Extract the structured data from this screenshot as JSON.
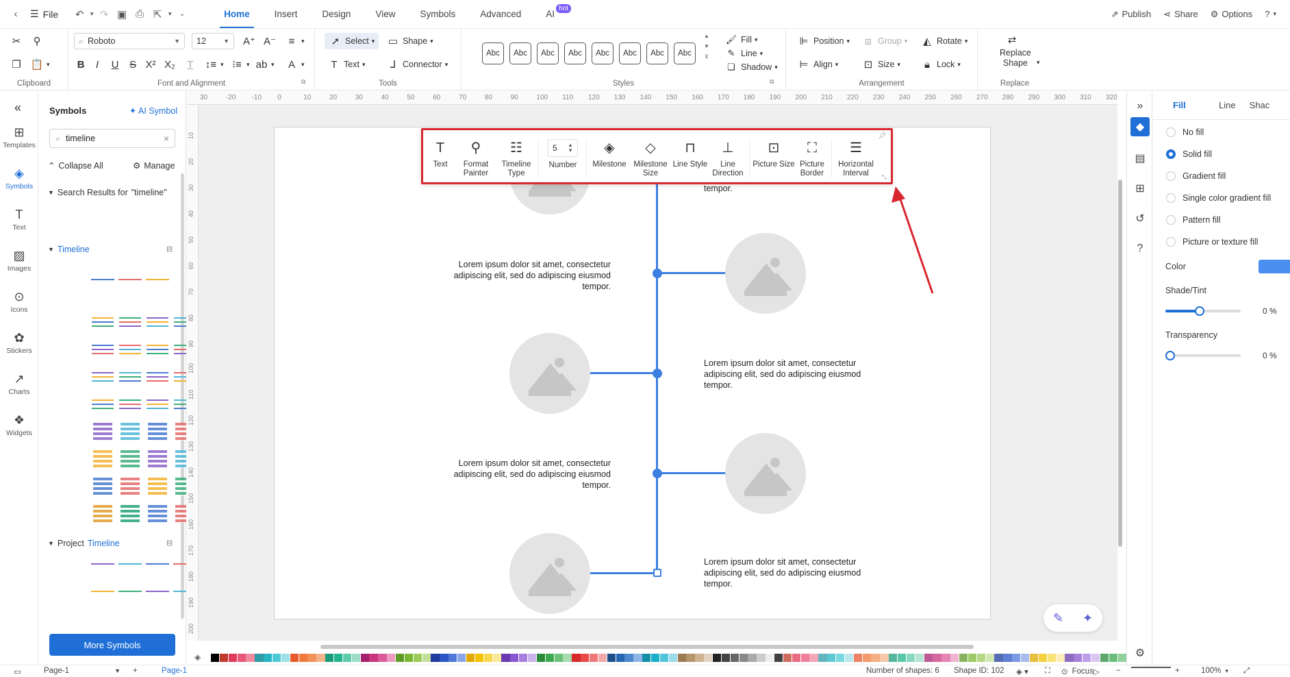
{
  "menubar": {
    "file_label": "File",
    "tabs": [
      {
        "label": "Home",
        "active": true
      },
      {
        "label": "Insert"
      },
      {
        "label": "Design"
      },
      {
        "label": "View"
      },
      {
        "label": "Symbols"
      },
      {
        "label": "Advanced"
      },
      {
        "label": "AI",
        "badge": "hot"
      }
    ],
    "right": {
      "publish": "Publish",
      "share": "Share",
      "options": "Options"
    }
  },
  "ribbon": {
    "font_name": "Roboto",
    "font_size": "12",
    "select_label": "Select",
    "shape_label": "Shape",
    "text_label": "Text",
    "connector_label": "Connector",
    "style_swatch": "Abc",
    "fill_label": "Fill",
    "line_label": "Line",
    "shadow_label": "Shadow",
    "position_label": "Position",
    "group_label": "Group",
    "rotate_label": "Rotate",
    "align_label": "Align",
    "size_label": "Size",
    "lock_label": "Lock",
    "replace_label_1": "Replace",
    "replace_label_2": "Shape",
    "groups": {
      "clipboard": "Clipboard",
      "font": "Font and Alignment",
      "tools": "Tools",
      "styles": "Styles",
      "arrangement": "Arrangement",
      "replace": "Replace"
    }
  },
  "rail": [
    {
      "label": "Templates",
      "icon": "templates-icon"
    },
    {
      "label": "Symbols",
      "icon": "symbols-icon",
      "active": true
    },
    {
      "label": "Text",
      "icon": "text-icon"
    },
    {
      "label": "Images",
      "icon": "images-icon"
    },
    {
      "label": "Icons",
      "icon": "icons-icon"
    },
    {
      "label": "Stickers",
      "icon": "stickers-icon"
    },
    {
      "label": "Charts",
      "icon": "charts-icon"
    },
    {
      "label": "Widgets",
      "icon": "widgets-icon"
    }
  ],
  "symbols": {
    "title": "Symbols",
    "ai_symbol": "AI Symbol",
    "search_value": "timeline",
    "collapse_all": "Collapse All",
    "manage": "Manage",
    "search_results_prefix": "Search Results for",
    "search_results_term": "\"timeline\"",
    "timeline_section": "Timeline",
    "project_prefix": "Project",
    "project_term": "Timeline",
    "more_symbols": "More Symbols"
  },
  "ruler": {
    "h": [
      "30",
      "-20",
      "-10",
      "0",
      "10",
      "20",
      "30",
      "40",
      "50",
      "60",
      "70",
      "80",
      "90",
      "100",
      "110",
      "120",
      "130",
      "140",
      "150",
      "160",
      "170",
      "180",
      "190",
      "200",
      "210",
      "220",
      "230",
      "240",
      "250",
      "260",
      "270",
      "280",
      "290",
      "300",
      "310",
      "320"
    ],
    "v": [
      "10",
      "20",
      "30",
      "40",
      "50",
      "60",
      "70",
      "80",
      "90",
      "100",
      "110",
      "120",
      "130",
      "140",
      "150",
      "160",
      "170",
      "180",
      "190",
      "200"
    ]
  },
  "canvas": {
    "lorem_line1": "Lorem ipsum dolor sit amet, consectetur",
    "lorem_line2": "adipiscing elit, sed do adipiscing eiusmod",
    "lorem_line3": "tempor.",
    "partial_text": "tempor."
  },
  "float_toolbar": {
    "items": [
      {
        "label": "Text",
        "icon": "text-tool-icon"
      },
      {
        "label": "Format\nPainter",
        "icon": "format-painter-icon"
      },
      {
        "label": "Timeline\nType",
        "icon": "timeline-type-icon"
      },
      {
        "label": "Number",
        "value": "5"
      },
      {
        "label": "Milestone",
        "icon": "milestone-icon"
      },
      {
        "label": "Milestone\nSize",
        "icon": "milestone-size-icon"
      },
      {
        "label": "Line Style",
        "icon": "line-style-icon"
      },
      {
        "label": "Line\nDirection",
        "icon": "line-direction-icon"
      },
      {
        "label": "Picture Size",
        "icon": "picture-size-icon"
      },
      {
        "label": "Picture\nBorder",
        "icon": "picture-border-icon"
      },
      {
        "label": "Horizontal\nInterval",
        "icon": "horizontal-interval-icon"
      }
    ]
  },
  "props": {
    "tabs": [
      "Fill",
      "Line",
      "Shac"
    ],
    "options": [
      {
        "label": "No fill",
        "checked": false
      },
      {
        "label": "Solid fill",
        "checked": true
      },
      {
        "label": "Gradient fill",
        "checked": false
      },
      {
        "label": "Single color gradient fill",
        "checked": false
      },
      {
        "label": "Pattern fill",
        "checked": false
      },
      {
        "label": "Picture or texture fill",
        "checked": false
      }
    ],
    "color_label": "Color",
    "color_value": "#4a8ff0",
    "shade_label": "Shade/Tint",
    "shade_value": "0 %",
    "shade_level": 0.45,
    "transparency_label": "Transparency",
    "transparency_value": "0 %",
    "transparency_level": 0
  },
  "status": {
    "page_select": "Page-1",
    "page_tab": "Page-1",
    "shapes": "Number of shapes: 6",
    "shape_id": "Shape ID: 102",
    "focus": "Focus",
    "zoom": "100%"
  },
  "palette": [
    "#000000",
    "#c0392b",
    "#e03a5a",
    "#e8567a",
    "#f08aa0",
    "#2e9aa5",
    "#25b5c5",
    "#4fc9d6",
    "#9fe0e8",
    "#e65a2e",
    "#f07a3c",
    "#f3935b",
    "#f5b38c",
    "#1a9c7a",
    "#22b58e",
    "#5fcbaa",
    "#9ddcc7",
    "#a6206f",
    "#c9357f",
    "#dc5c9b",
    "#eb9bc0",
    "#5f9a28",
    "#7cb734",
    "#9ccb5b",
    "#c3df99",
    "#1f3b9c",
    "#2a56c6",
    "#4f78d8",
    "#8aa5e6",
    "#e0a800",
    "#f2c200",
    "#f7d84a",
    "#f9e79a",
    "#6a3bb0",
    "#8a55d0",
    "#a77ee0",
    "#cbb2ec",
    "#2a8a3a",
    "#3aa84c",
    "#6cc07a",
    "#a6dcaf",
    "#d62828",
    "#e84a4a",
    "#ef7676",
    "#f4a9a9",
    "#1c4e8a",
    "#2467b3",
    "#4d8ad0",
    "#8db4e3",
    "#128fa6",
    "#1aaecb",
    "#52c4db",
    "#9adcea",
    "#9b7a50",
    "#b7956a",
    "#cdb391",
    "#e1d2bd",
    "#222222",
    "#444444",
    "#666666",
    "#888888",
    "#aaaaaa",
    "#cccccc",
    "#eeeeee"
  ],
  "style_count": 8
}
